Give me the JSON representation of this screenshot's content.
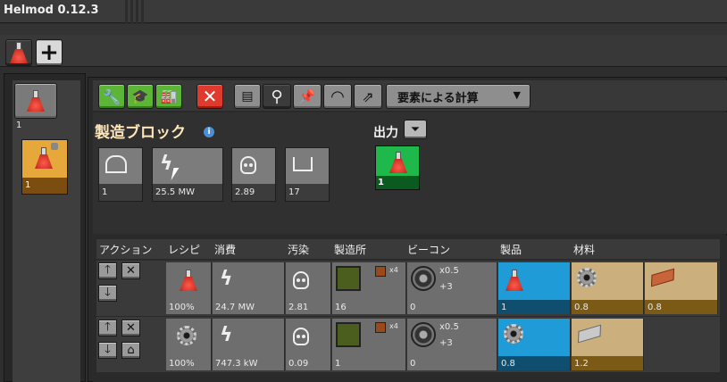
{
  "app": {
    "title": "Helmod 0.12.3"
  },
  "toolbar": {
    "new_tab_label": "+",
    "calc_mode": "要素による計算",
    "buttons": [
      {
        "name": "wrench-icon",
        "glyph": "🔧"
      },
      {
        "name": "graduation-cap-icon",
        "glyph": "🎓"
      },
      {
        "name": "factory-icon",
        "glyph": "🏭"
      },
      {
        "name": "close-icon",
        "glyph": "✕"
      },
      {
        "name": "document-icon",
        "glyph": "▤"
      },
      {
        "name": "link-icon",
        "glyph": "⚲"
      },
      {
        "name": "pin-icon",
        "glyph": "📌"
      },
      {
        "name": "speedometer-icon",
        "glyph": "◠"
      },
      {
        "name": "export-icon",
        "glyph": "⇗"
      }
    ]
  },
  "sidebar": {
    "items": [
      {
        "count": "1",
        "selected": false
      },
      {
        "count": "1",
        "selected": true
      }
    ]
  },
  "block": {
    "title": "製造ブロック",
    "info_glyph": "i",
    "stats": [
      {
        "name": "building-count",
        "icon": "building",
        "value": "1"
      },
      {
        "name": "power-consumption",
        "icon": "bolt",
        "value": "25.5 MW"
      },
      {
        "name": "pollution",
        "icon": "skull",
        "value": "2.89"
      },
      {
        "name": "factory-count",
        "icon": "factory",
        "value": "17"
      }
    ],
    "output_label": "出力",
    "output_value": "1"
  },
  "table": {
    "headers": [
      "アクション",
      "レシピ",
      "消費",
      "汚染",
      "製造所",
      "ビーコン",
      "製品",
      "材料"
    ],
    "rows": [
      {
        "recipe_pct": "100%",
        "power": "24.7 MW",
        "pollution": "2.81",
        "factory_count": "16",
        "module_mult": "x4",
        "beacon_speed": "x0.5",
        "beacon_plus": "+3",
        "beacon_count": "0",
        "products": [
          "1"
        ],
        "ingredients": [
          "0.8",
          "0.8"
        ]
      },
      {
        "recipe_pct": "100%",
        "power": "747.3 kW",
        "pollution": "0.09",
        "factory_count": "1",
        "module_mult": "x4",
        "beacon_speed": "x0.5",
        "beacon_plus": "+3",
        "beacon_count": "0",
        "products": [
          "0.8"
        ],
        "ingredients": [
          "1.2"
        ]
      }
    ]
  },
  "colors": {
    "accent_orange": "#e6a83a",
    "product_blue": "#1f9bd8",
    "ingredient_tan": "#cbb07d",
    "output_green": "#1fb84a"
  }
}
